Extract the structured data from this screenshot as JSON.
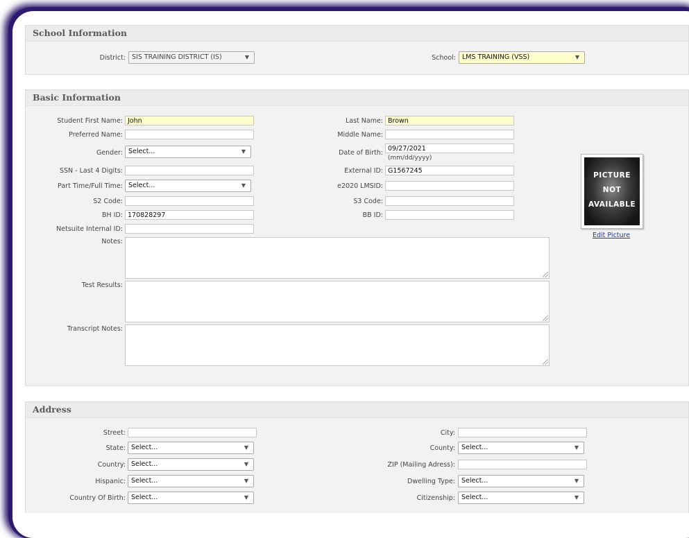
{
  "school_info": {
    "title": "School Information",
    "district_label": "District:",
    "district_value": "SIS TRAINING DISTRICT (IS)",
    "school_label": "School:",
    "school_value": "LMS TRAINING (VSS)"
  },
  "basic_info": {
    "title": "Basic Information",
    "first_name_label": "Student First Name:",
    "first_name_value": "John",
    "last_name_label": "Last Name:",
    "last_name_value": "Brown",
    "preferred_name_label": "Preferred Name:",
    "middle_name_label": "Middle Name:",
    "gender_label": "Gender:",
    "gender_value": "Select...",
    "dob_label": "Date of Birth:",
    "dob_value": "09/27/2021",
    "dob_hint": "(mm/dd/yyyy)",
    "ssn_label": "SSN - Last 4 Digits:",
    "external_id_label": "External ID:",
    "external_id_value": "G1567245",
    "parttime_label": "Part Time/Full Time:",
    "parttime_value": "Select...",
    "e2020_label": "e2020 LMSID:",
    "s2_label": "S2 Code:",
    "s3_label": "S3 Code:",
    "bh_label": "BH ID:",
    "bh_value": "170828297",
    "bb_label": "BB ID:",
    "netsuite_label": "Netsuite Internal ID:",
    "notes_label": "Notes:",
    "test_results_label": "Test Results:",
    "transcript_notes_label": "Transcript Notes:",
    "picture_line1": "PICTURE",
    "picture_line2": "NOT",
    "picture_line3": "AVAILABLE",
    "edit_picture": "Edit Picture"
  },
  "address": {
    "title": "Address",
    "street_label": "Street:",
    "city_label": "City:",
    "state_label": "State:",
    "state_value": "Select...",
    "county_label": "County:",
    "county_value": "Select...",
    "country_label": "Country:",
    "country_value": "Select...",
    "zip_label": "ZIP (Mailing Adress):",
    "hispanic_label": "Hispanic:",
    "hispanic_value": "Select...",
    "dwelling_label": "Dwelling Type:",
    "dwelling_value": "Select...",
    "country_birth_label": "Country Of Birth:",
    "country_birth_value": "Select...",
    "citizenship_label": "Citizenship:",
    "citizenship_value": "Select..."
  }
}
